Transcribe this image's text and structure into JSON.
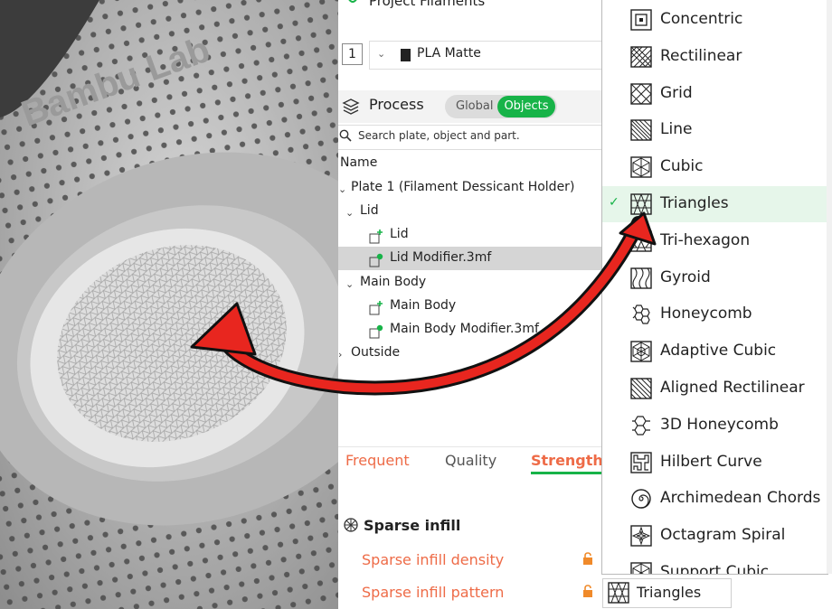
{
  "photo": {
    "logo_text": "Bambu Lab"
  },
  "panel": {
    "filaments_title": "Project Filaments",
    "filament_index": "1",
    "filament_name": "PLA Matte",
    "process_title": "Process",
    "toggle_global": "Global",
    "toggle_objects": "Objects",
    "search_placeholder": "Search plate, object and part.",
    "column_name": "Name"
  },
  "tree": {
    "plate": "Plate 1 (Filament Dessicant Holder)",
    "lid_group": "Lid",
    "lid_part": "Lid",
    "lid_modifier": "Lid Modifier.3mf",
    "main_group": "Main Body",
    "main_part": "Main Body",
    "main_modifier": "Main Body Modifier.3mf",
    "outside": "Outside"
  },
  "tabs": [
    "Frequent",
    "Quality",
    "Strength"
  ],
  "params": {
    "section": "Sparse infill",
    "density_label": "Sparse infill density",
    "pattern_label": "Sparse infill pattern",
    "pattern_value": "Triangles"
  },
  "dropdown": {
    "items": [
      "Concentric",
      "Rectilinear",
      "Grid",
      "Line",
      "Cubic",
      "Triangles",
      "Tri-hexagon",
      "Gyroid",
      "Honeycomb",
      "Adaptive Cubic",
      "Aligned Rectilinear",
      "3D Honeycomb",
      "Hilbert Curve",
      "Archimedean Chords",
      "Octagram Spiral",
      "Support Cubic"
    ],
    "selected": "Triangles"
  },
  "colors": {
    "accent": "#17b348",
    "param_label": "#ee6b47",
    "arrow": "#e8261f"
  }
}
